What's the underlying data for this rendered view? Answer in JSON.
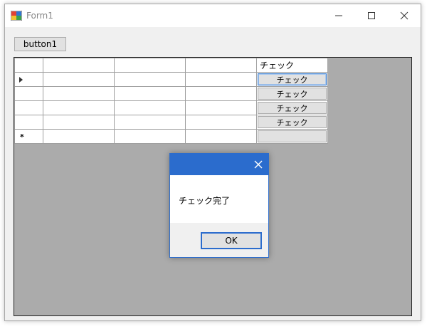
{
  "window": {
    "title": "Form1"
  },
  "toolbar": {
    "button1_label": "button1"
  },
  "grid": {
    "check_column_header": "チェック",
    "rows": [
      {
        "button_label": "チェック",
        "current": true
      },
      {
        "button_label": "チェック",
        "current": false
      },
      {
        "button_label": "チェック",
        "current": false
      },
      {
        "button_label": "チェック",
        "current": false
      }
    ],
    "new_row_marker": "*"
  },
  "dialog": {
    "message": "チェック完了",
    "ok_label": "OK"
  }
}
